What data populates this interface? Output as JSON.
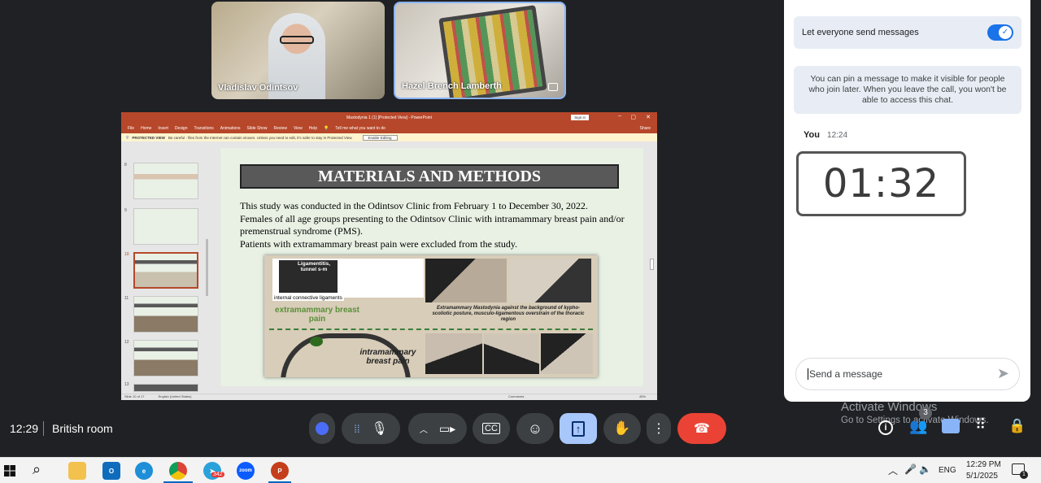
{
  "participants": [
    {
      "name": "Vladislav Odintsov"
    },
    {
      "name": "Hazel Brench Lamberth"
    }
  ],
  "ppt": {
    "window_title": "Mastodynia 1 (1) [Protected View] - PowerPoint",
    "sign_in": "Sign in",
    "menu": [
      "File",
      "Home",
      "Insert",
      "Design",
      "Transitions",
      "Animations",
      "Slide Show",
      "Review",
      "View",
      "Help",
      "Tell me what you want to do"
    ],
    "share": "Share",
    "protected_label": "PROTECTED VIEW",
    "protected_msg": "Be careful - files from the Internet can contain viruses. Unless you need to edit, it's safer to stay in Protected View.",
    "enable_editing": "Enable Editing",
    "thumb_numbers": [
      "8",
      "9",
      "10",
      "11",
      "12",
      "13"
    ],
    "slide": {
      "title": "MATERIALS AND METHODS",
      "paragraphs": [
        "This study was conducted in the Odintsov Clinic from February 1 to December 30, 2022.",
        "Females of all age groups presenting to the Odintsov Clinic with intramammary breast pain and/or premenstrual syndrome (PMS).",
        "Patients with extramammary breast pain were excluded from the study."
      ],
      "figure": {
        "label_ligament": "Ligamentitis, tunnel s-m",
        "label_connective": "internal connective ligaments",
        "label_extra": "extramammary breast pain",
        "label_caption": "Extramammary Mastodynia against the background of kypho-scoliotic posture, musculo-ligamentous overstrain of the thoracic region",
        "label_intra": "intramammary breast pain"
      }
    },
    "status_left": "Slide 10 of 17",
    "status_lang": "English (United States)",
    "status_comments": "Comments",
    "status_zoom": "45%"
  },
  "chat": {
    "toggle_label": "Let everyone send messages",
    "toggle_on": true,
    "pin_info": "You can pin a message to make it visible for people who join later. When you leave the call, you won't be able to access this chat.",
    "sender": "You",
    "time": "12:24",
    "timer": "01:32",
    "input_placeholder": "Send a message"
  },
  "meeting": {
    "time": "12:29",
    "room": "British room",
    "people_count": "3"
  },
  "activate": {
    "title": "Activate Windows",
    "subtitle": "Go to Settings to activate Windows."
  },
  "taskbar": {
    "telegram_badge": "342",
    "zoom_label": "zoom",
    "lang": "ENG",
    "clock_time": "12:29 PM",
    "clock_date": "5/1/2025",
    "notif_count": "1"
  },
  "colors": {
    "accent": "#1a73e8",
    "end_call": "#ea4335",
    "ppt_red": "#b7472a",
    "present_active": "#a8c7fa"
  }
}
